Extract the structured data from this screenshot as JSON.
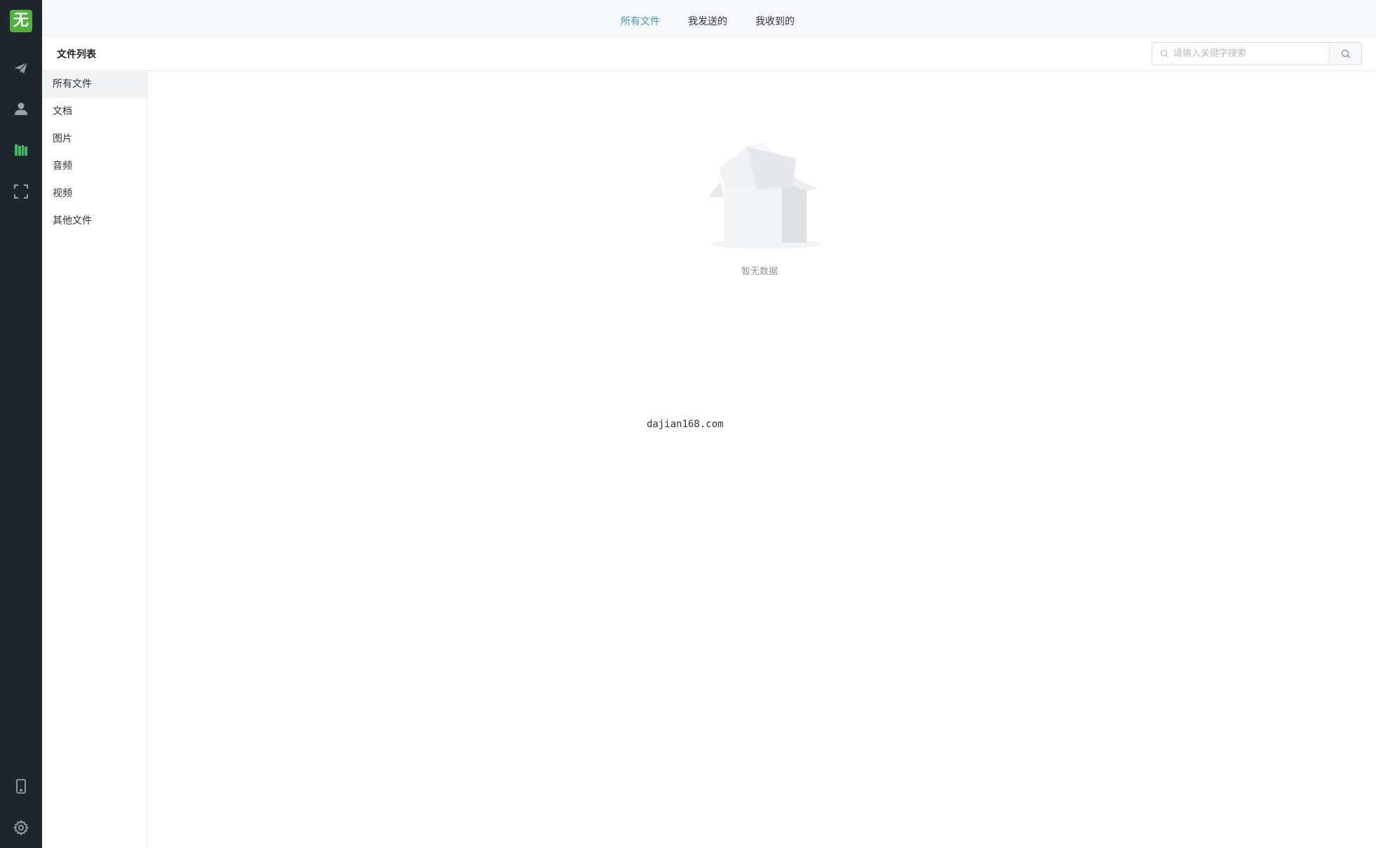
{
  "app": {
    "logo_char": "无",
    "colors": {
      "rail_bg": "#1f262d",
      "logo_bg": "#52b33c",
      "active_tab": "#3d96ce",
      "active_rail_icon": "#35c05e",
      "rail_icon": "#9aa1a9"
    }
  },
  "rail": {
    "icons": [
      "send-icon",
      "contacts-icon",
      "library-icon",
      "scan-icon",
      "phone-icon",
      "gear-icon"
    ],
    "active": "library-icon"
  },
  "topbar": {
    "tabs": [
      {
        "label": "所有文件",
        "active": true
      },
      {
        "label": "我发送的",
        "active": false
      },
      {
        "label": "我收到的",
        "active": false
      }
    ]
  },
  "header": {
    "title": "文件列表",
    "search": {
      "placeholder": "请输入关键字搜索",
      "value": ""
    }
  },
  "categories": {
    "items": [
      {
        "label": "所有文件",
        "active": true
      },
      {
        "label": "文档",
        "active": false
      },
      {
        "label": "图片",
        "active": false
      },
      {
        "label": "音频",
        "active": false
      },
      {
        "label": "视频",
        "active": false
      },
      {
        "label": "其他文件",
        "active": false
      }
    ]
  },
  "main": {
    "empty_text": "暂无数据",
    "watermark": "dajian168.com"
  }
}
